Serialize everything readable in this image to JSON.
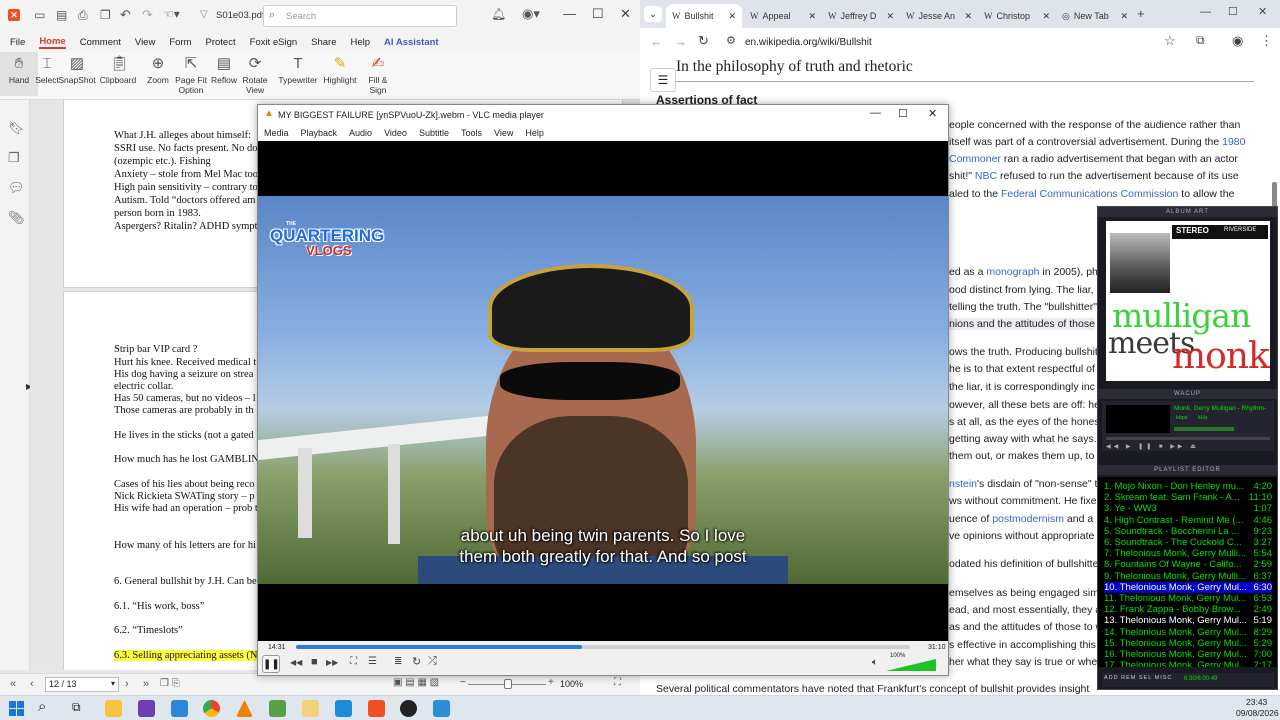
{
  "pdf_app": {
    "filename": "S01e03.pdf",
    "search_placeholder": "Search",
    "menu": [
      "File",
      "Home",
      "Comment",
      "View",
      "Form",
      "Protect",
      "Foxit eSign",
      "Share",
      "Help",
      "AI Assistant"
    ],
    "active_menu": "Home",
    "ribbon": [
      {
        "label": "Hand",
        "icon": "hand-icon"
      },
      {
        "label": "Select",
        "icon": "select-icon"
      },
      {
        "label": "SnapShot",
        "icon": "snapshot-icon"
      },
      {
        "label": "Clipboard",
        "icon": "clipboard-icon"
      },
      {
        "label": "Zoom",
        "icon": "zoom-icon"
      },
      {
        "label": "Page Fit Option",
        "icon": "page-fit-icon"
      },
      {
        "label": "Reflow",
        "icon": "reflow-icon"
      },
      {
        "label": "Rotate View",
        "icon": "rotate-icon"
      },
      {
        "label": "Typewriter",
        "icon": "typewriter-icon"
      },
      {
        "label": "Highlight",
        "icon": "highlight-icon"
      },
      {
        "label": "Fill & Sign",
        "icon": "fill-sign-icon"
      }
    ],
    "page1_lines": [
      "What J.H. alleges about himself:",
      "SSRI use. No facts present. No do",
      "(ozempic etc.). Fishing",
      "Anxiety – stole from Mel Mac too",
      "High pain sensitivity – contrary to",
      "Autism. Told “doctors offered am",
      "person born in 1983.",
      "Aspergers? Ritalin? ADHD symptoms"
    ],
    "page2_lines": [
      "Strip bar VIP card ?",
      "Hurt his knee. Received medical t",
      "His dog having a seizure on strea",
      "electric collar.",
      "Has 50 cameras, but no videos – l",
      "Those cameras are probably in th",
      "He lives in the sticks (not a gated",
      "How much has he lost GAMBLIN",
      "Cases of his lies about being reco",
      "Nick Rickieta SWATing story – p",
      "His wife had an operation – prob t",
      "How many of his letters are for hi",
      "6. General bullshit by J.H. Can be",
      "6.1. “His work, boss”",
      "6.2. “Timeslots”",
      "6.3. Selling appreciating assets (N"
    ],
    "page_indicator": "12 / 13",
    "zoom": "100%"
  },
  "browser": {
    "tabs": [
      "Bullshit",
      "Appeal",
      "Jeffrey D",
      "Jesse An",
      "Christop",
      "New Tab"
    ],
    "active_tab": "Bullshit",
    "url": "en.wikipedia.org/wiki/Bullshit",
    "heading": "In the philosophy of truth and rhetoric",
    "subheading": "Assertions of fact",
    "lines": [
      {
        "t": "eople concerned with the response of the audience rather than"
      },
      {
        "t": "itself was part of a controversial advertisement. During the ",
        "link": "1980"
      },
      {
        "link": "Commoner",
        "t": " ran a radio advertisement that began with an actor"
      },
      {
        "t": "shit!\" ",
        "link": "NBC",
        "t2": " refused to run the advertisement because of its use"
      },
      {
        "t": "aled to the ",
        "link": "Federal Communications Commission",
        "t2": " to allow the"
      },
      {
        "t": "ed as a ",
        "link": "monograph",
        "t2": " in 2005), ph"
      },
      {
        "t": "ood distinct from lying. The liar, "
      },
      {
        "t": "telling the truth. The \"bullshitter\""
      },
      {
        "t": "nions and the attitudes of those"
      },
      {
        "t": "ows the truth. Producing bullshit"
      },
      {
        "t": "he is to that extent respectful of"
      },
      {
        "t": " the liar, it is correspondingly inc"
      },
      {
        "t": "owever, all these bets are off: he"
      },
      {
        "t": "s at all, as the eyes of the hones"
      },
      {
        "t": "getting away with what he says."
      },
      {
        "t": " them out, or makes them up, to"
      },
      {
        "link": "nstein",
        "t2": "'s disdain of \"non-sense\" t"
      },
      {
        "t": "ws without commitment. He fixes"
      },
      {
        "t": "uence of ",
        "link": "postmodernism",
        "t2": " and a"
      },
      {
        "t": "ve opinions without appropriate"
      },
      {
        "t": "odated his definition of bullshitte"
      },
      {
        "t": "emselves as being engaged sim"
      },
      {
        "t": "ead, and most essentially, they a"
      },
      {
        "t": "as and the attitudes of those to w"
      },
      {
        "t": "s effective in accomplishing this"
      },
      {
        "t": "her what they say is true or whe"
      }
    ],
    "bottom_line": "Several political commentators have noted that Frankfurt's concept of bullshit provides insight"
  },
  "vlc": {
    "title": "MY BIGGEST FAILURE [ynSPVuoU-Zk].webm - VLC media player",
    "menu": [
      "Media",
      "Playback",
      "Audio",
      "Video",
      "Subtitle",
      "Tools",
      "View",
      "Help"
    ],
    "logo_line1": "THE",
    "logo_line2": "QUARTERING",
    "logo_line3": "VLOGS",
    "subtitle_line1": "about uh being twin parents. So I love",
    "subtitle_line2": "them both greatly for that. And so post",
    "time_elapsed": "14:31",
    "time_total": "31:10",
    "progress": 0.466,
    "volume": "100%"
  },
  "winamp": {
    "album_art_title": "ALBUM ART",
    "album_line1": "STEREO",
    "album_line2": "RIVERSIDE",
    "album_word1": "mulligan",
    "album_word2": "meets",
    "album_word3": "monk",
    "wacup_title": "WACUP",
    "marquee": "Monk, Gerry Mulligan - Rhythm-",
    "kbps": "kbps",
    "khz": "kHz",
    "playlist_title": "PLAYLIST EDITOR",
    "playlist": [
      {
        "n": "1. Mojo Nixon - Don Henley mu...",
        "d": "4:20"
      },
      {
        "n": "2. Skream feat. Sam Frank - A...",
        "d": "11:10"
      },
      {
        "n": "3. Ye - WW3",
        "d": "1:07"
      },
      {
        "n": "4. High Contrast - Remind Me (...",
        "d": "4:46"
      },
      {
        "n": "5. Soundtrack - Boccherini La ...",
        "d": "9:23"
      },
      {
        "n": "6. Soundtrack - The Cuckold C...",
        "d": "3:27"
      },
      {
        "n": "7. Thelonious Monk, Gerry Mulli...",
        "d": "5:54"
      },
      {
        "n": "8. Fountains Of Wayne - Califo...",
        "d": "2:59"
      },
      {
        "n": "9. Thelonious Monk, Gerry Mulli...",
        "d": "6:37"
      },
      {
        "n": "10. Thelonious Monk, Gerry Mul...",
        "d": "6:30"
      },
      {
        "n": "11. Thelonious Monk, Gerry Mul...",
        "d": "6:53"
      },
      {
        "n": "12. Frank Zappa - Bobby Brow...",
        "d": "2:49"
      },
      {
        "n": "13. Thelonious Monk, Gerry Mul...",
        "d": "5:19"
      },
      {
        "n": "14. Thelonious Monk, Gerry Mul...",
        "d": "8:29"
      },
      {
        "n": "15. Thelonious Monk, Gerry Mul...",
        "d": "5:29"
      },
      {
        "n": "16. Thelonious Monk, Gerry Mul...",
        "d": "7:00"
      },
      {
        "n": "17. Thelonious Monk, Gerry Mul...",
        "d": "7:17"
      }
    ],
    "selected_index": 9,
    "current_index": 12,
    "footer_time": "6:30/6:00:49"
  },
  "taskbar": {
    "time": "23:43",
    "date": "09/08/2026"
  }
}
